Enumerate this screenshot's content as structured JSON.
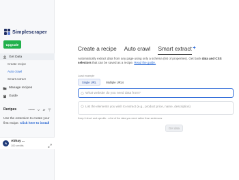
{
  "sidebar": {
    "brand": "Simplescraper",
    "upgrade_label": "Upgrade",
    "get_data_label": "Get Data",
    "sub_items": [
      "Create recipe",
      "Auto crawl",
      "Smart extract"
    ],
    "manage_label": "Manage recipes",
    "guide_label": "Guide",
    "recipes_title": "Recipes",
    "recipes_sort": "name",
    "recipes_note_text": "Use the extension to create your first recipe.",
    "recipes_note_link": "Click here to install",
    "user_initial": "A",
    "user_name": "Abhay ...",
    "user_credits": "100 credits"
  },
  "main": {
    "tabs": [
      "Create a recipe",
      "Auto crawl",
      "Smart extract"
    ],
    "desc_before": "Automatically extract data from any page using only a schema (list of properties). Get back",
    "desc_bold": "data and CSS selectors",
    "desc_after": "that can be saved as a recipe.",
    "desc_link": "Read the guide.",
    "load_label": "Load example",
    "seg": [
      "Single URL",
      "Multiple URLs"
    ],
    "url_placeholder": "What website do you need data from?",
    "props_placeholder": "List the elements you wish to extract (e.g., product price, name, description)",
    "hint": "Keep it short and specific - a list of the data you need rather than sentences",
    "get_data_button": "Get data"
  },
  "colors": {
    "accent": "#2f6bd8",
    "upgrade": "#22b14c",
    "brand": "#1f2f64"
  }
}
